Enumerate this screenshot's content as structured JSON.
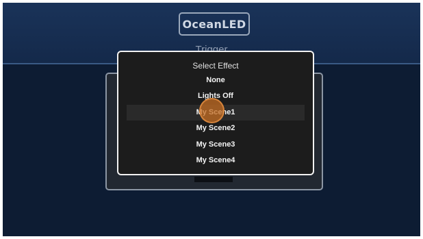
{
  "header": {
    "logo_text": "OceanLED",
    "title": "Trigger"
  },
  "dialog": {
    "title": "Select Effect",
    "options": [
      {
        "label": "None"
      },
      {
        "label": "Lights Off"
      },
      {
        "label": "My Scene1",
        "selected": true
      },
      {
        "label": "My Scene2"
      },
      {
        "label": "My Scene3"
      },
      {
        "label": "My Scene4"
      }
    ]
  },
  "colors": {
    "background": "#0d1c33",
    "header": "#1a3359",
    "dialog_background": "#1c1c1c",
    "dialog_border": "#f2f2f2",
    "touch_indicator": "#c46c22"
  }
}
